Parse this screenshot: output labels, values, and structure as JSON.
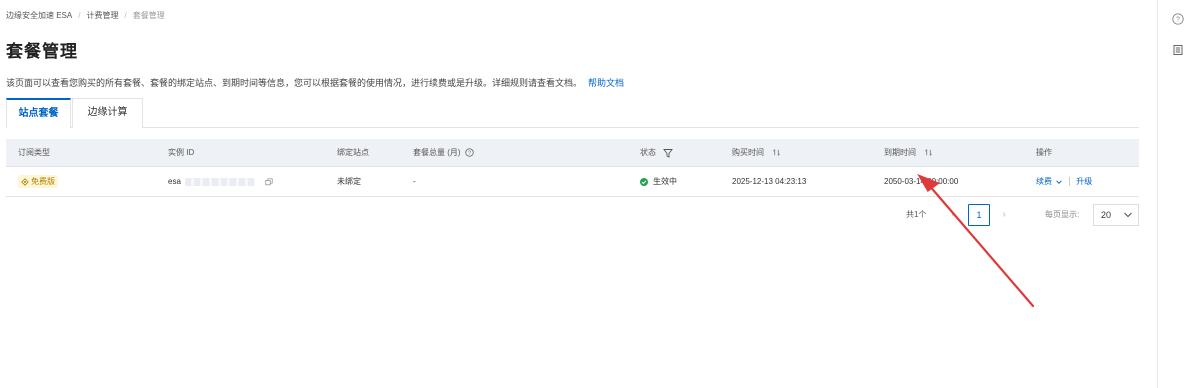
{
  "breadcrumb": [
    "边缘安全加速 ESA",
    "计费管理",
    "套餐管理"
  ],
  "page": {
    "title": "套餐管理",
    "description": "该页面可以查看您购买的所有套餐、套餐的绑定站点、到期时间等信息，您可以根据套餐的使用情况，进行续费或是升级。详细规则请查看文档。",
    "help_link": "帮助文档"
  },
  "tabs": [
    {
      "label": "站点套餐",
      "active": true
    },
    {
      "label": "边缘计算",
      "active": false
    }
  ],
  "table": {
    "headers": {
      "type": "订阅类型",
      "instance": "实例 ID",
      "site": "绑定站点",
      "quota": "套餐总量 (月)",
      "status": "状态",
      "purchase": "购买时间",
      "expire": "到期时间",
      "actions": "操作"
    },
    "rows": [
      {
        "type": "免费版",
        "instance_prefix": "esa",
        "site": "未绑定",
        "quota": "-",
        "status": "生效中",
        "purchase": "2025-12-13 04:23:13",
        "expire": "2050-03-14 00:00:00",
        "renew": "续费",
        "upgrade": "升级"
      }
    ]
  },
  "pagination": {
    "total": "共1个",
    "current_page": "1",
    "page_size_label": "每页显示:",
    "page_size": "20"
  },
  "colors": {
    "accent": "#0064c8",
    "status_active": "#1fa44a",
    "badge_bg": "#fff6d6",
    "annotation_arrow": "#e0393b"
  },
  "icons": [
    "help-circle-icon",
    "document-list-icon",
    "sort-icon",
    "filter-icon",
    "copy-icon",
    "chevron-down-icon",
    "chevron-left-icon",
    "chevron-right-icon"
  ]
}
